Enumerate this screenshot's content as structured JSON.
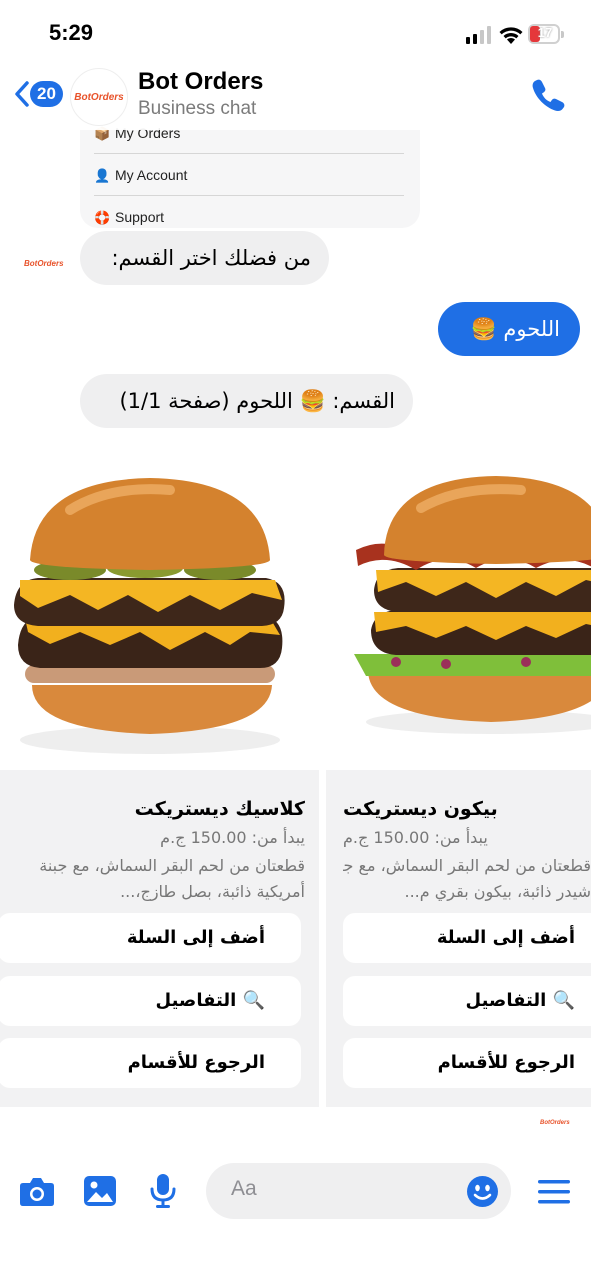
{
  "status_bar": {
    "time": "5:29",
    "battery": "17"
  },
  "header": {
    "back_count": "20",
    "avatar_logo": "BotOrders",
    "title": "Bot Orders",
    "subtitle": "Business chat"
  },
  "menu_card": {
    "items": [
      {
        "icon": "package-icon",
        "label": "My Orders"
      },
      {
        "icon": "person-icon",
        "label": "My Account"
      },
      {
        "icon": "lifebuoy-icon",
        "label": "Support"
      }
    ]
  },
  "messages": {
    "choose_section": "من فضلك اختر القسم:",
    "user_reply": "اللحوم 🍔",
    "section_header": "القسم: 🍔 اللحوم (صفحة 1/1)",
    "avatar_logo_small": "BotOrders"
  },
  "products": [
    {
      "name": "كلاسيك ديستريكت",
      "price": "يبدأ من: 150.00 ج.م",
      "desc_line1": "قطعتان من لحم البقر السماش، مع جبنة",
      "desc_line2": "أمريكية ذائبة، بصل طازج،...",
      "btn_add": "أضف إلى السلة",
      "btn_details": "🔍 التفاصيل",
      "btn_back": "الرجوع للأقسام"
    },
    {
      "name": "بيكون ديستريكت",
      "price": "يبدأ من: 150.00 ج.م",
      "desc_line1": "قطعتان من لحم البقر السماش، مع جبنة",
      "desc_line2": "شيدر ذائبة، بيكون بقري م...",
      "btn_add": "أضف إلى السلة",
      "btn_details": "🔍 التفاصيل",
      "btn_back": "الرجوع للأقسام"
    }
  ],
  "composer": {
    "placeholder": "Aa"
  },
  "colors": {
    "accent": "#1f6fe5",
    "bubble_in": "#efeff0",
    "brand": "#e8532b"
  }
}
